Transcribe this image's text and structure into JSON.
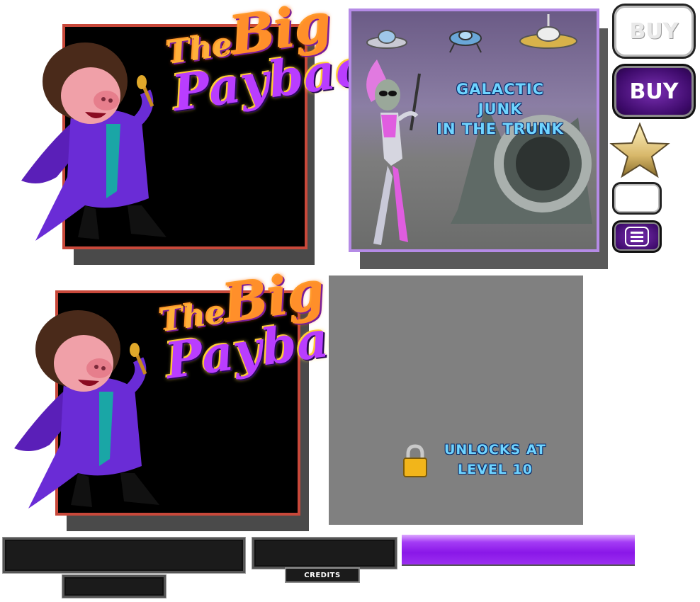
{
  "promo_cards": [
    {
      "logo": {
        "line1": "The",
        "line2": "Big",
        "line3": "Payback"
      }
    },
    {
      "logo": {
        "line1": "The",
        "line2": "Big",
        "line3": "Payback"
      }
    }
  ],
  "game_tile": {
    "title_lines": [
      "GALACTIC",
      "JUNK",
      "IN THE TRUNK"
    ],
    "icons": [
      "ufo-icon",
      "ufo-icon",
      "ufo-icon",
      "alien-character",
      "rocket-ship"
    ]
  },
  "buttons": {
    "buy_normal": "BUY",
    "buy_pressed": "BUY",
    "star_icon": "star-icon",
    "menu_icon": "menu-icon"
  },
  "locked_tile": {
    "line1": "UNLOCKS AT",
    "line2": "LEVEL 10",
    "icon": "padlock-icon"
  },
  "bottom": {
    "credits_label": "CREDITS"
  },
  "colors": {
    "card_border": "#c8483a",
    "tile_border": "#b58be6",
    "accent_purple": "#8a17e8",
    "title_blue": "#6fd4ff"
  }
}
